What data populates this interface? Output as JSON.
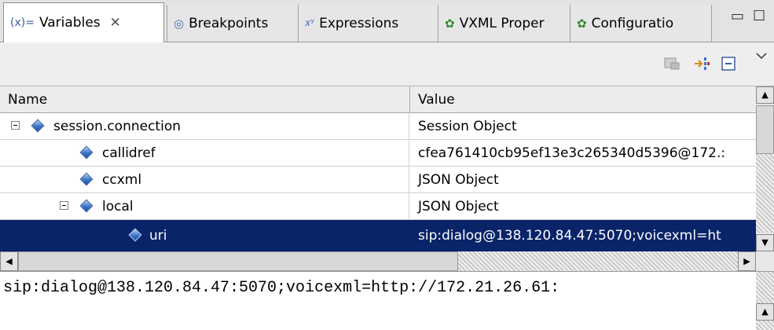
{
  "tabs": [
    {
      "icon": "(x)=",
      "label": "Variables",
      "close": "✕",
      "active": true
    },
    {
      "label": "Breakpoints"
    },
    {
      "label": "Expressions"
    },
    {
      "label": "VXML Proper"
    },
    {
      "label": "Configuratio"
    }
  ],
  "columns": {
    "name": "Name",
    "value": "Value"
  },
  "rows": [
    {
      "name": "session.connection",
      "value": "Session Object",
      "expanded": true,
      "level": 0
    },
    {
      "name": "callidref",
      "value": "cfea761410cb95ef13e3c265340d5396@172.:",
      "level": 1
    },
    {
      "name": "ccxml",
      "value": "JSON Object",
      "level": 1
    },
    {
      "name": "local",
      "value": "JSON Object",
      "expanded": true,
      "level": 1
    },
    {
      "name": "uri",
      "value": "sip:dialog@138.120.84.47:5070;voicexml=ht",
      "level": 2,
      "selected": true
    }
  ],
  "detail": {
    "text": "sip:dialog@138.120.84.47:5070;voicexml=http://172.21.26.61:"
  },
  "colors": {
    "selection": "#0a246a",
    "accent": "#3b74c8"
  }
}
